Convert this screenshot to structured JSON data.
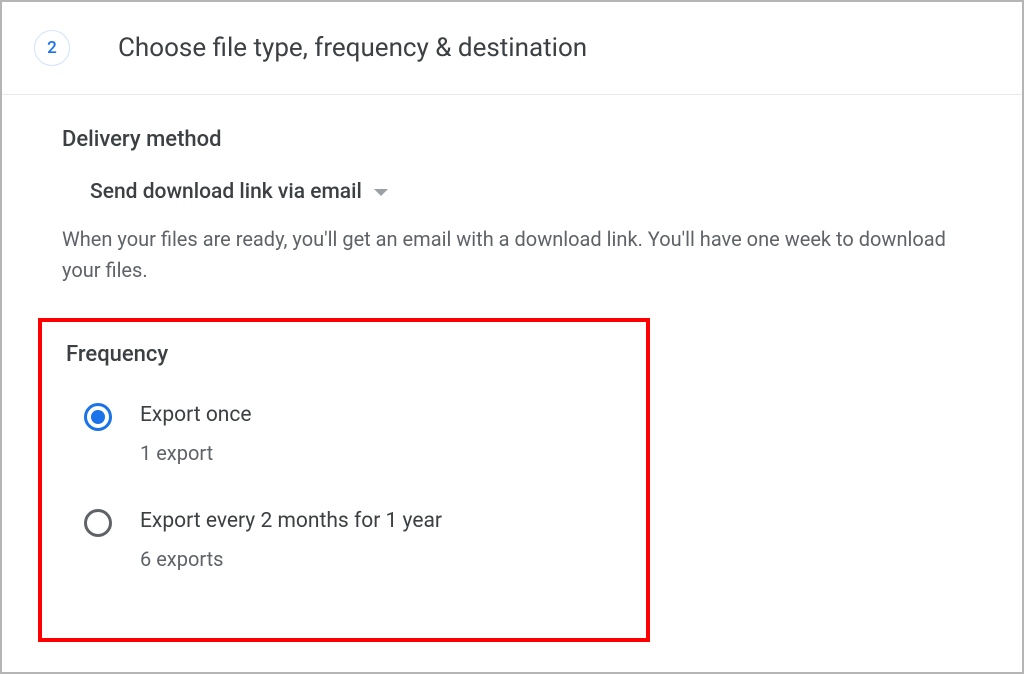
{
  "step": {
    "number": "2",
    "title": "Choose file type, frequency & destination"
  },
  "delivery": {
    "section_label": "Delivery method",
    "dropdown_value": "Send download link via email",
    "helper_text": "When your files are ready, you'll get an email with a download link. You'll have one week to download your files."
  },
  "frequency": {
    "section_label": "Frequency",
    "options": [
      {
        "label": "Export once",
        "sub": "1 export",
        "selected": true
      },
      {
        "label": "Export every 2 months for 1 year",
        "sub": "6 exports",
        "selected": false
      }
    ]
  }
}
